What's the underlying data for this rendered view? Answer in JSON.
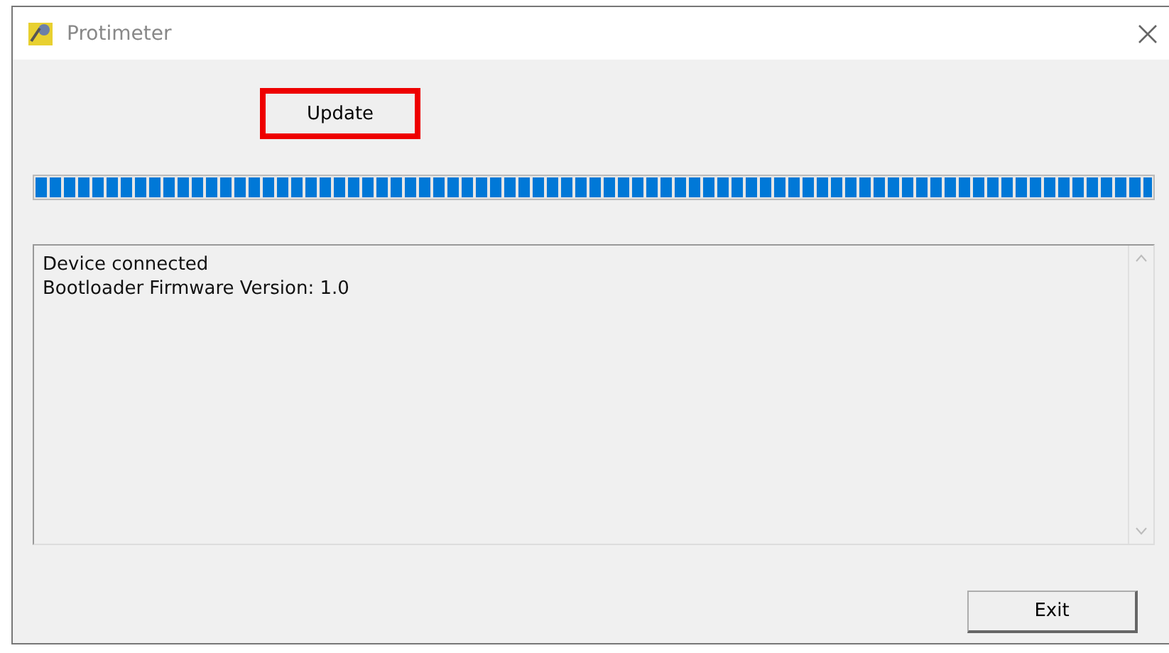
{
  "window": {
    "title": "Protimeter"
  },
  "update_button": {
    "label": "Update",
    "highlighted": true
  },
  "progress": {
    "level": 1
  },
  "log": {
    "lines": [
      "Device connected",
      "Bootloader Firmware Version: 1.0"
    ]
  },
  "exit_button": {
    "label": "Exit"
  }
}
